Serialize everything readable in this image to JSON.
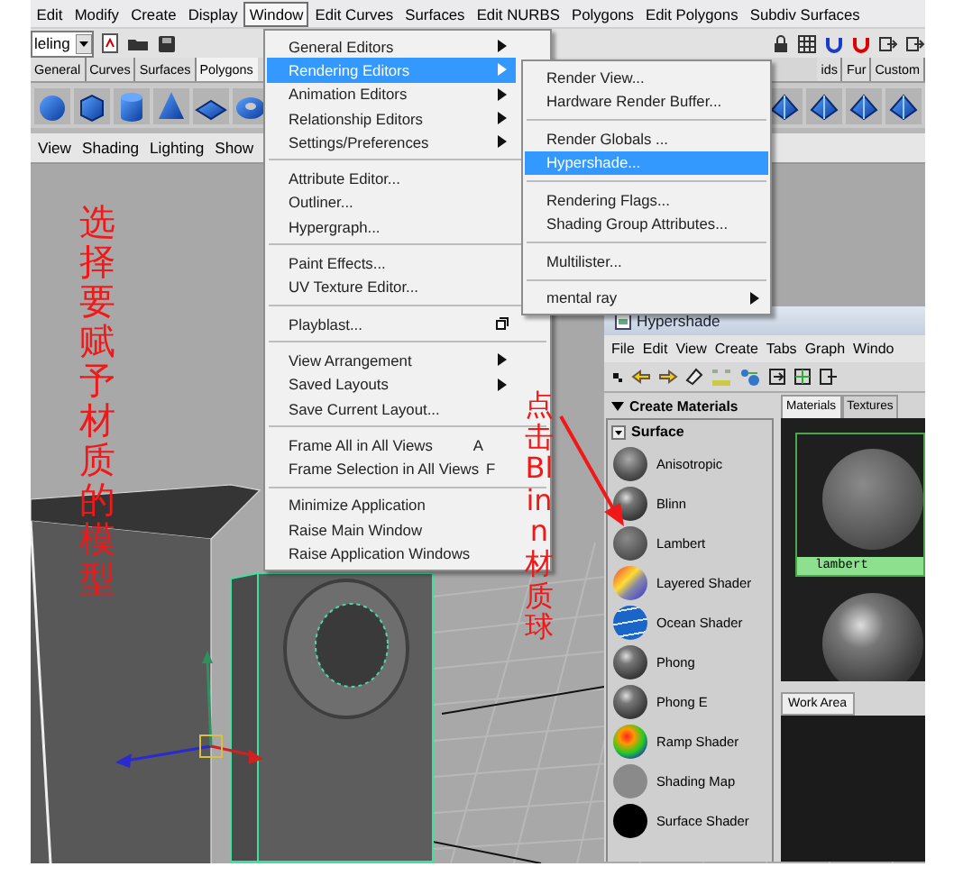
{
  "menu_bar": {
    "items": [
      {
        "label": "Edit",
        "selected": false
      },
      {
        "label": "Modify",
        "selected": false
      },
      {
        "label": "Create",
        "selected": false
      },
      {
        "label": "Display",
        "selected": false
      },
      {
        "label": "Window",
        "selected": true
      },
      {
        "label": "Edit Curves",
        "selected": false
      },
      {
        "label": "Surfaces",
        "selected": false
      },
      {
        "label": "Edit NURBS",
        "selected": false
      },
      {
        "label": "Polygons",
        "selected": false
      },
      {
        "label": "Edit Polygons",
        "selected": false
      },
      {
        "label": "Subdiv Surfaces",
        "selected": false
      }
    ]
  },
  "status_line": {
    "mode_menu": "leling"
  },
  "shelf": {
    "left_tabs": [
      {
        "label": "General",
        "selected": false
      },
      {
        "label": "Curves",
        "selected": false
      },
      {
        "label": "Surfaces",
        "selected": false
      },
      {
        "label": "Polygons",
        "selected": true
      }
    ],
    "right_tabs": [
      {
        "label": "ids",
        "selected": false
      },
      {
        "label": "Fur",
        "selected": false
      },
      {
        "label": "Custom",
        "selected": false
      }
    ]
  },
  "viewport": {
    "panel_menu": [
      "View",
      "Shading",
      "Lighting",
      "Show"
    ]
  },
  "window_menu": {
    "items": [
      {
        "kind": "item",
        "label": "General Editors",
        "submenu": true,
        "selected": false
      },
      {
        "kind": "item",
        "label": "Rendering Editors",
        "submenu": true,
        "selected": true,
        "option_box": false
      },
      {
        "kind": "item",
        "label": "Animation Editors",
        "submenu": true,
        "selected": false,
        "option_box": false
      },
      {
        "kind": "item",
        "label": "Relationship Editors",
        "submenu": true,
        "selected": false,
        "option_box": false
      },
      {
        "kind": "item",
        "label": "Settings/Preferences",
        "submenu": true,
        "selected": false,
        "option_box": false
      },
      {
        "kind": "separator"
      },
      {
        "kind": "item",
        "label": "Attribute Editor...",
        "submenu": false,
        "selected": false,
        "option_box": false
      },
      {
        "kind": "item",
        "label": "Outliner...",
        "submenu": false,
        "selected": false,
        "option_box": false
      },
      {
        "kind": "item",
        "label": "Hypergraph...",
        "submenu": false,
        "selected": false,
        "option_box": false
      },
      {
        "kind": "separator"
      },
      {
        "kind": "item",
        "label": "Paint Effects...",
        "submenu": false,
        "selected": false,
        "option_box": false
      },
      {
        "kind": "item",
        "label": "UV Texture Editor...",
        "submenu": false,
        "selected": false,
        "option_box": false
      },
      {
        "kind": "separator"
      },
      {
        "kind": "item",
        "label": "Playblast...",
        "submenu": false,
        "selected": false,
        "option_box": true
      },
      {
        "kind": "separator"
      },
      {
        "kind": "item",
        "label": "View Arrangement",
        "submenu": true,
        "selected": false,
        "option_box": false
      },
      {
        "kind": "item",
        "label": "Saved Layouts",
        "submenu": true,
        "selected": false,
        "option_box": false
      },
      {
        "kind": "item",
        "label": "Save Current Layout...",
        "submenu": false,
        "selected": false,
        "option_box": false
      },
      {
        "kind": "separator"
      },
      {
        "kind": "item",
        "label": "Frame All in All Views",
        "shortcut": "A",
        "submenu": false,
        "selected": false,
        "option_box": false
      },
      {
        "kind": "item",
        "label": "Frame Selection in All Views",
        "shortcut": "F",
        "submenu": false,
        "selected": false,
        "option_box": false
      },
      {
        "kind": "separator"
      },
      {
        "kind": "item",
        "label": "Minimize Application",
        "submenu": false,
        "selected": false,
        "option_box": false
      },
      {
        "kind": "item",
        "label": "Raise Main Window",
        "submenu": false,
        "selected": false,
        "option_box": false
      },
      {
        "kind": "item",
        "label": "Raise Application Windows",
        "submenu": false,
        "selected": false,
        "option_box": false
      }
    ]
  },
  "rendering_submenu": {
    "items": [
      {
        "kind": "item",
        "label": "Render View...",
        "submenu": false,
        "selected": false,
        "option_box": false
      },
      {
        "kind": "item",
        "label": "Hardware Render Buffer...",
        "submenu": false,
        "selected": false,
        "option_box": false
      },
      {
        "kind": "separator"
      },
      {
        "kind": "item",
        "label": "Render Globals ...",
        "submenu": false,
        "selected": false,
        "option_box": false
      },
      {
        "kind": "item",
        "label": "Hypershade...",
        "submenu": false,
        "selected": true,
        "option_box": false
      },
      {
        "kind": "separator"
      },
      {
        "kind": "item",
        "label": "Rendering Flags...",
        "submenu": false,
        "selected": false,
        "option_box": false
      },
      {
        "kind": "item",
        "label": "Shading Group Attributes...",
        "submenu": false,
        "selected": false,
        "option_box": false
      },
      {
        "kind": "separator"
      },
      {
        "kind": "item",
        "label": "Multilister...",
        "submenu": false,
        "selected": false,
        "option_box": false
      },
      {
        "kind": "separator"
      },
      {
        "kind": "item",
        "label": "mental ray",
        "submenu": true,
        "selected": false,
        "option_box": false
      }
    ]
  },
  "hypershade": {
    "title": "Hypershade",
    "menu": [
      "File",
      "Edit",
      "View",
      "Create",
      "Tabs",
      "Graph",
      "Windo"
    ],
    "create_panel": {
      "title": "Create Materials",
      "section": "Surface",
      "materials": [
        {
          "name": "Anisotropic",
          "kind": "anisotropic"
        },
        {
          "name": "Blinn",
          "kind": "glossy"
        },
        {
          "name": "Lambert",
          "kind": "matte"
        },
        {
          "name": "Layered Shader",
          "kind": "layered"
        },
        {
          "name": "Ocean Shader",
          "kind": "ocean"
        },
        {
          "name": "Phong",
          "kind": "glossy"
        },
        {
          "name": "Phong E",
          "kind": "glossy"
        },
        {
          "name": "Ramp Shader",
          "kind": "ramp"
        },
        {
          "name": "Shading Map",
          "kind": "flat"
        },
        {
          "name": "Surface Shader",
          "kind": "dark"
        }
      ]
    },
    "tabs": [
      {
        "label": "Materials",
        "selected": true
      },
      {
        "label": "Textures",
        "selected": false
      }
    ],
    "swatches": [
      {
        "label": "lambert",
        "kind": "matte",
        "selected": true
      },
      {
        "kind": "glossy",
        "selected": false
      }
    ],
    "work_area_tab": "Work Area"
  },
  "annotations": [
    {
      "text": "选择要赋予材质的模型"
    },
    {
      "text": "点击Blinn材质球"
    }
  ]
}
